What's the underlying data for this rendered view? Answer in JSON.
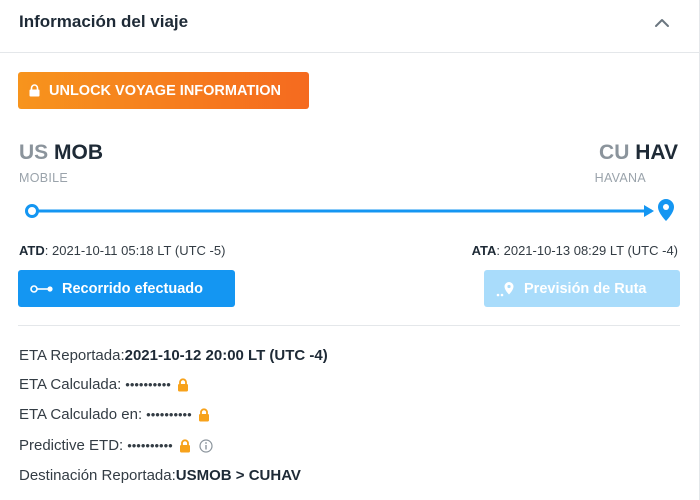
{
  "header": {
    "title": "Información del viaje"
  },
  "unlock_button": {
    "label": "UNLOCK VOYAGE INFORMATION",
    "color": "#f7941d"
  },
  "route": {
    "origin": {
      "country": "US",
      "port": "MOB",
      "city": "MOBILE"
    },
    "destination": {
      "country": "CU",
      "port": "HAV",
      "city": "HAVANA"
    },
    "line_color": "#1496f2",
    "atd": {
      "label": "ATD",
      "value": ": 2021-10-11 05:18 LT (UTC -5)"
    },
    "ata": {
      "label": "ATA",
      "value": ": 2021-10-13 08:29 LT (UTC -4)"
    }
  },
  "buttons": {
    "recorrido": "Recorrido efectuado",
    "prevision": "Previsión de Ruta"
  },
  "details": {
    "eta_reportada": {
      "label": "ETA Reportada: ",
      "value": "2021-10-12 20:00 LT (UTC -4)"
    },
    "eta_calculada": {
      "label": "ETA Calculada: ",
      "value": "••••••••••"
    },
    "eta_calculado_en": {
      "label": "ETA Calculado en: ",
      "value": "••••••••••"
    },
    "predictive_etd": {
      "label": "Predictive ETD: ",
      "value": "••••••••••"
    },
    "destinacion": {
      "label": "Destinación Reportada: ",
      "value": "USMOB > CUHAV"
    }
  },
  "colors": {
    "lock": "#f7a21b",
    "primary": "#1496f2",
    "disabled": "#a9dcfb"
  }
}
